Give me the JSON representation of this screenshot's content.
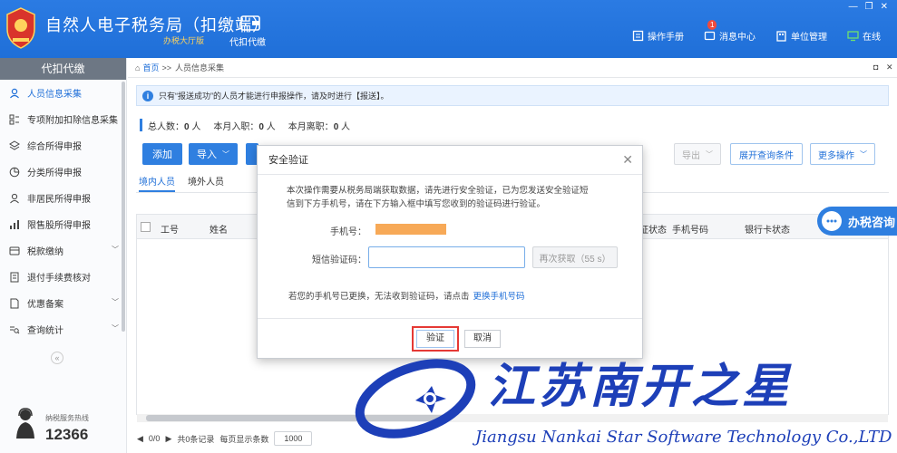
{
  "header": {
    "title": "自然人电子税务局（扣缴端）",
    "subtitle": "办税大厅版",
    "module_label": "代扣代缴",
    "links": [
      {
        "label": "操作手册",
        "icon": "manual-icon"
      },
      {
        "label": "消息中心",
        "icon": "message-icon",
        "badge": "1"
      },
      {
        "label": "单位管理",
        "icon": "unit-icon"
      },
      {
        "label": "在线",
        "icon": "online-icon"
      }
    ]
  },
  "sidebar": {
    "header": "代扣代缴",
    "items": [
      {
        "label": "人员信息采集",
        "active": true
      },
      {
        "label": "专项附加扣除信息采集"
      },
      {
        "label": "综合所得申报"
      },
      {
        "label": "分类所得申报"
      },
      {
        "label": "非居民所得申报"
      },
      {
        "label": "限售股所得申报"
      },
      {
        "label": "税款缴纳",
        "chevron": true
      },
      {
        "label": "退付手续费核对"
      },
      {
        "label": "优惠备案",
        "chevron": true
      },
      {
        "label": "查询统计",
        "chevron": true
      }
    ],
    "collapse_glyph": "«",
    "hotline_label": "纳税服务热线",
    "hotline_number": "12366"
  },
  "breadcrumb": {
    "home": "首页",
    "separator": ">>",
    "current": "人员信息采集"
  },
  "notice": "只有“报送成功”的人员才能进行申报操作，请及时进行【报送】。",
  "stats": {
    "total_label": "总人数：",
    "total": "0",
    "total_unit": "人",
    "joined_label": "本月入职：",
    "joined": "0",
    "joined_unit": "人",
    "left_label": "本月离职：",
    "left": "0",
    "left_unit": "人"
  },
  "toolbar": {
    "add": "添加",
    "import": "导入",
    "export": "导出",
    "expand_query": "展开查询条件",
    "more_ops": "更多操作"
  },
  "tabs": [
    "境内人员",
    "境外人员"
  ],
  "table": {
    "columns": [
      "工号",
      "姓名",
      "证状态",
      "手机号码",
      "银行卡状态"
    ]
  },
  "pager": {
    "pages": "0/0",
    "records": "共0条记录",
    "per_page_label": "每页显示条数",
    "per_page": "1000"
  },
  "consult": "办税咨询",
  "dialog": {
    "title": "安全验证",
    "message": "本次操作需要从税务局端获取数据，请先进行安全验证，已为您发送安全验证短信到下方手机号，请在下方输入框中填写您收到的验证码进行验证。",
    "phone_label": "手机号：",
    "code_label": "短信验证码：",
    "code_value": "",
    "resend": "再次获取（55 s）",
    "hint": "若您的手机号已更换，无法收到验证码，请点击",
    "hint_link": "更换手机号码",
    "verify": "验证",
    "cancel": "取消"
  },
  "watermark": {
    "text": "江苏南开之星",
    "subtext": "Jiangsu Nankai Star Software Technology Co.,LTD"
  },
  "colors": {
    "primary": "#2f7fe0",
    "header": "#1f6fd8",
    "highlight": "#e53935",
    "watermark": "#1d3fb8"
  }
}
